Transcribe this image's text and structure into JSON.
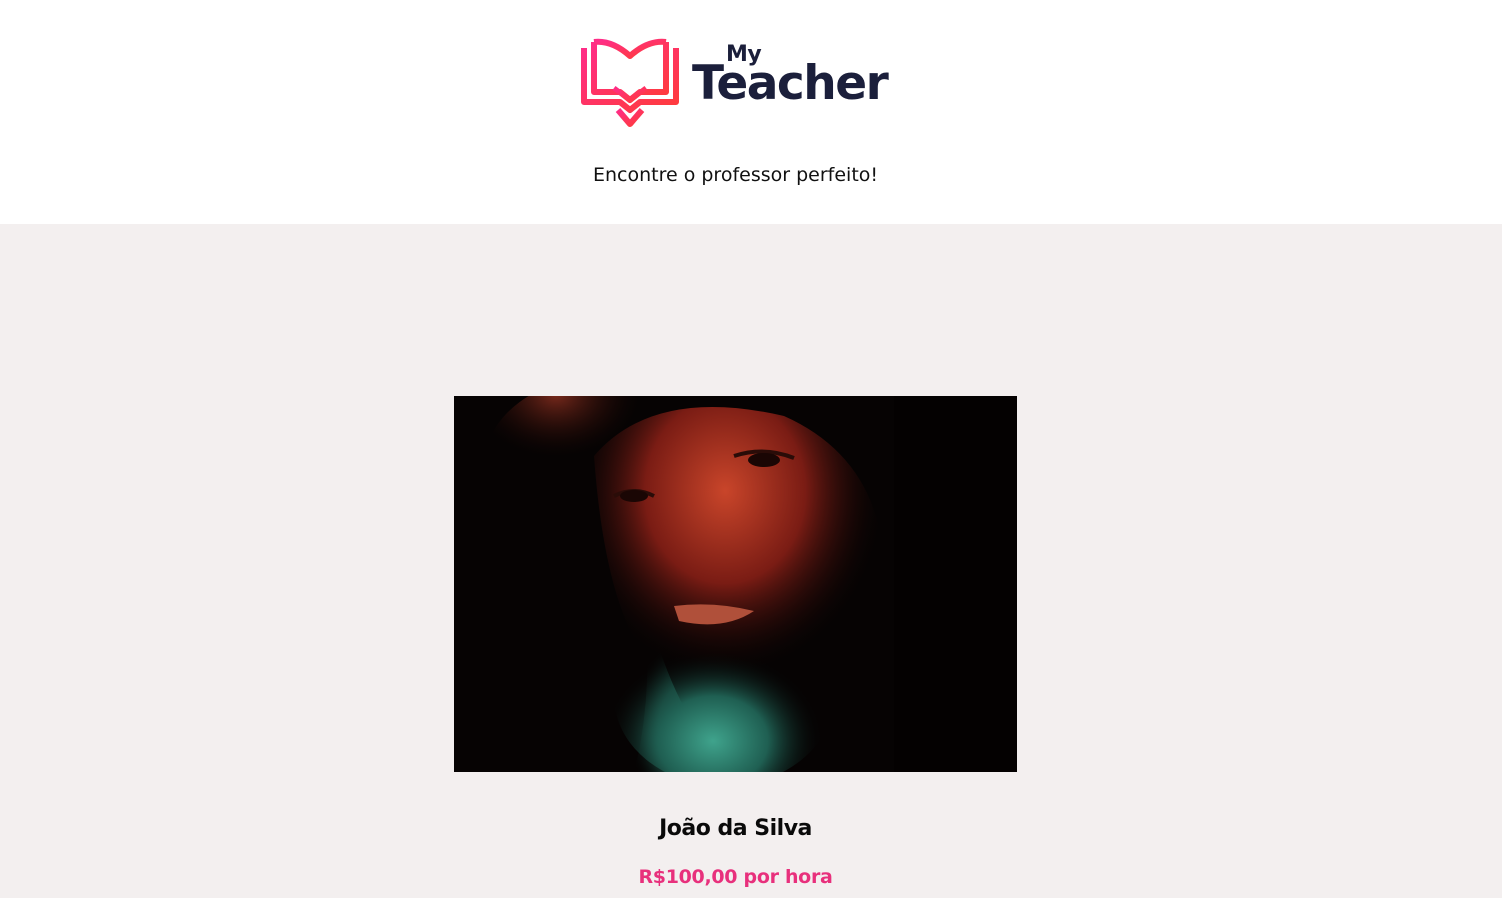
{
  "brand": {
    "small_word": "My",
    "big_word": "Teacher",
    "gradient_start": "#ff2d87",
    "gradient_end": "#ff3b3b",
    "text_color": "#1b1f3b",
    "icon": "book-heart-icon"
  },
  "header": {
    "tagline": "Encontre o professor perfeito!"
  },
  "teacher_card": {
    "photo_icon": "teacher-portrait-photo",
    "name": "João da Silva",
    "price": "R$100,00 por hora",
    "price_color": "#e8307c"
  },
  "colors": {
    "page_background": "#f3efef",
    "header_background": "#ffffff"
  }
}
